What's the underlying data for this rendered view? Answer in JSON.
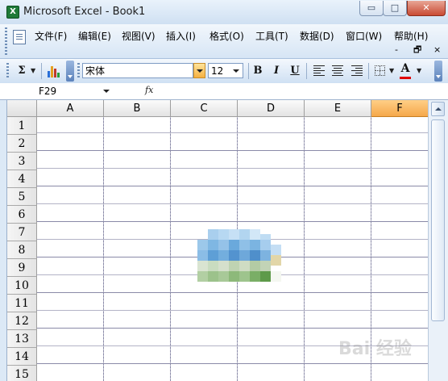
{
  "window": {
    "title": "Microsoft Excel - Book1",
    "controls": {
      "minimize": "▭",
      "maximize": "□",
      "close": "✕"
    }
  },
  "menu": {
    "items": [
      {
        "label": "文件(F)"
      },
      {
        "label": "编辑(E)"
      },
      {
        "label": "视图(V)"
      },
      {
        "label": "插入(I)"
      },
      {
        "label": "格式(O)"
      },
      {
        "label": "工具(T)"
      },
      {
        "label": "数据(D)"
      },
      {
        "label": "窗口(W)"
      },
      {
        "label": "帮助(H)"
      }
    ],
    "doc_controls": {
      "minimize": "-",
      "restore": "🗗",
      "close": "×"
    }
  },
  "toolbar": {
    "autosum": "Σ",
    "font_name": "宋体",
    "font_size": "12",
    "bold": "B",
    "italic": "I",
    "underline": "U",
    "font_color_letter": "A"
  },
  "formula_bar": {
    "name_box": "F29",
    "fx": "fx",
    "formula": ""
  },
  "sheet": {
    "columns": [
      "A",
      "B",
      "C",
      "D",
      "E",
      "F"
    ],
    "active_column": "F",
    "rows": [
      "1",
      "2",
      "3",
      "4",
      "5",
      "6",
      "7",
      "8",
      "9",
      "10",
      "11",
      "12",
      "13",
      "14",
      "15"
    ]
  },
  "colors": {
    "active_header": "#f5a84a",
    "grid_line": "#8a8aa8",
    "title_bar": "#dce9f6"
  },
  "watermark": "Bai 经验"
}
